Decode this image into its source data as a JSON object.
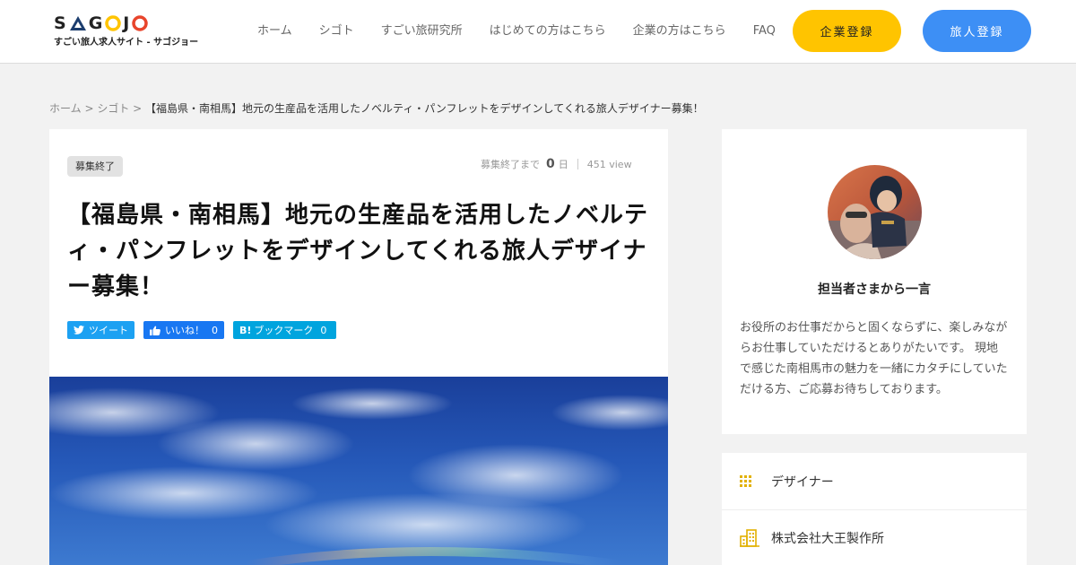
{
  "header": {
    "logo_letters": [
      "S",
      "G",
      "J"
    ],
    "logo_tagline": "すごい旅人求人サイト - サゴジョー",
    "nav": [
      "ホーム",
      "シゴト",
      "すごい旅研究所",
      "はじめての方はこちら",
      "企業の方はこちら",
      "FAQ"
    ],
    "corp_button": "企業登録",
    "traveler_button": "旅人登録",
    "accent_yellow": "#ffc400",
    "accent_blue": "#3d8ff5"
  },
  "breadcrumb": {
    "home": "ホーム",
    "sep1": " > ",
    "jobs": "シゴト",
    "sep2": " > ",
    "current": "【福島県・南相馬】地元の生産品を活用したノベルティ・パンフレットをデザインしてくれる旅人デザイナー募集！"
  },
  "job": {
    "status": "募集終了",
    "deadline_label": "募集終了まで",
    "days": "0",
    "days_unit": "日",
    "views": "451 view",
    "title": "【福島県・南相馬】地元の生産品を活用したノベルティ・パンフレットをデザインしてくれる旅人デザイナー募集！"
  },
  "share": {
    "tweet": "ツイート",
    "like": "いいね！",
    "like_count": "0",
    "bookmark": "ブックマーク",
    "bookmark_count": "0"
  },
  "sidebar": {
    "comment_title": "担当者さまから一言",
    "comment_text": "お役所のお仕事だからと固くならずに、楽しみながらお仕事していただけるとありがたいです。 現地で感じた南相馬市の魅力を一緒にカタチにしていただける方、ご応募お待ちしております。",
    "category": "デザイナー",
    "company": "株式会社大王製作所",
    "category_icon": "grid-icon",
    "company_icon": "building-icon"
  }
}
